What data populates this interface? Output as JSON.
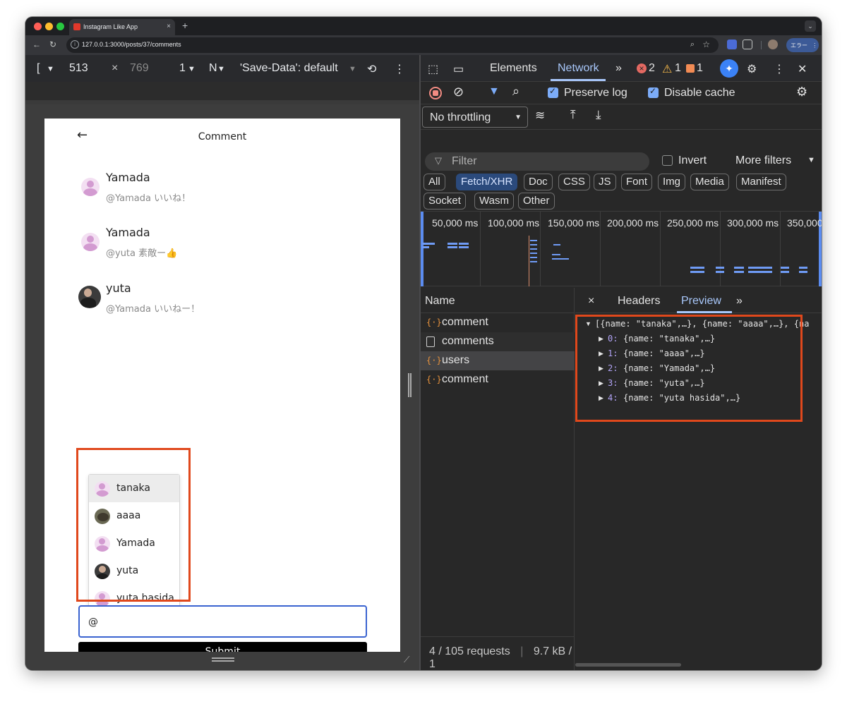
{
  "browser": {
    "tab_title": "Instagram Like App",
    "tab_close": "×",
    "new_tab": "+",
    "url": "127.0.0.1:3000/posts/37/comments",
    "profile_error_label": "エラー",
    "icons": [
      "back-icon",
      "reload-icon",
      "info-icon",
      "zoom-icon",
      "star-icon",
      "extension-icon",
      "puzzle-icon",
      "profile-icon",
      "menu-icon"
    ]
  },
  "device_toolbar": {
    "dimensions_menu": "[",
    "width": "513",
    "times": "×",
    "height": "769",
    "dpr": "1",
    "throttle_short": "N",
    "save_data": "'Save-Data': default"
  },
  "app": {
    "page_title": "Comment",
    "back_arrow": "←",
    "comments": [
      {
        "name": "Yamada",
        "text": "@Yamada いいね！",
        "avatar": "default"
      },
      {
        "name": "Yamada",
        "text": "@yuta 素敵ー👍",
        "avatar": "default"
      },
      {
        "name": "yuta",
        "text": "@Yamada いいねー！",
        "avatar": "photo"
      }
    ],
    "mention_suggestions": [
      {
        "name": "tanaka",
        "avatar": "default",
        "highlighted": true
      },
      {
        "name": "aaaa",
        "avatar": "photo2",
        "highlighted": false
      },
      {
        "name": "Yamada",
        "avatar": "default",
        "highlighted": false
      },
      {
        "name": "yuta",
        "avatar": "photo",
        "highlighted": false
      },
      {
        "name": "yuta hasida",
        "avatar": "default",
        "highlighted": false
      }
    ],
    "input_value": "@",
    "submit_label": "Submit"
  },
  "devtools": {
    "tabs": [
      "Elements",
      "Network"
    ],
    "active_tab": "Network",
    "more_tabs": "»",
    "errors": "2",
    "warnings": "1",
    "issues": "1",
    "preserve_log": "Preserve log",
    "disable_cache": "Disable cache",
    "throttling": "No throttling",
    "filter_placeholder": "Filter",
    "invert": "Invert",
    "more_filters": "More filters",
    "type_filters": [
      "All",
      "Fetch/XHR",
      "Doc",
      "CSS",
      "JS",
      "Font",
      "Img",
      "Media",
      "Manifest",
      "Socket",
      "Wasm",
      "Other"
    ],
    "active_filter": "Fetch/XHR",
    "timeline_ticks": [
      "50,000 ms",
      "100,000 ms",
      "150,000 ms",
      "200,000 ms",
      "250,000 ms",
      "300,000 ms",
      "350,000"
    ],
    "name_header": "Name",
    "requests": [
      {
        "name": "comment",
        "type": "json"
      },
      {
        "name": "comments",
        "type": "doc"
      },
      {
        "name": "users",
        "type": "json"
      },
      {
        "name": "comment",
        "type": "json"
      }
    ],
    "selected_request": "users",
    "status_requests": "4 / 105 requests",
    "status_size": "9.7 kB / 1",
    "detail_tabs": [
      "Headers",
      "Preview"
    ],
    "active_detail_tab": "Preview",
    "detail_close": "×",
    "preview": {
      "summary": "[{name: \"tanaka\",…}, {name: \"aaaa\",…}, {na",
      "items": [
        {
          "index": "0:",
          "value": "{name: \"tanaka\",…}"
        },
        {
          "index": "1:",
          "value": "{name: \"aaaa\",…}"
        },
        {
          "index": "2:",
          "value": "{name: \"Yamada\",…}"
        },
        {
          "index": "3:",
          "value": "{name: \"yuta\",…}"
        },
        {
          "index": "4:",
          "value": "{name: \"yuta hasida\",…}"
        }
      ]
    }
  },
  "colors": {
    "highlight_box": "#e0481c",
    "devtools_accent": "#a8c7fa",
    "input_focus": "#3a63d0"
  }
}
